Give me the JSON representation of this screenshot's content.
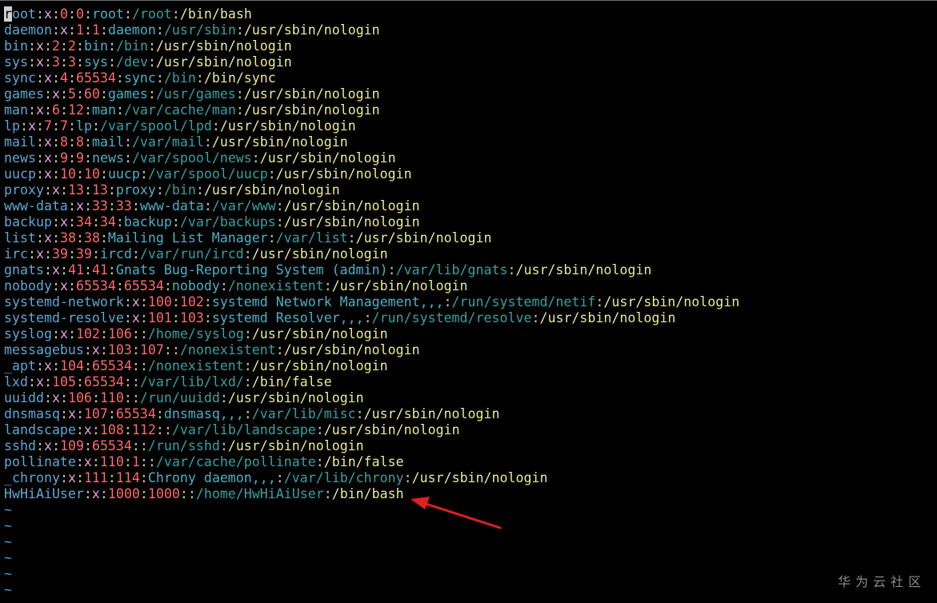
{
  "terminal": {
    "lines": [
      {
        "user": "root",
        "pw": "x",
        "uid": "0",
        "gid": "0",
        "gecos": "root",
        "home": "/root",
        "shell": "/bin/bash"
      },
      {
        "user": "daemon",
        "pw": "x",
        "uid": "1",
        "gid": "1",
        "gecos": "daemon",
        "home": "/usr/sbin",
        "shell": "/usr/sbin/nologin"
      },
      {
        "user": "bin",
        "pw": "x",
        "uid": "2",
        "gid": "2",
        "gecos": "bin",
        "home": "/bin",
        "shell": "/usr/sbin/nologin"
      },
      {
        "user": "sys",
        "pw": "x",
        "uid": "3",
        "gid": "3",
        "gecos": "sys",
        "home": "/dev",
        "shell": "/usr/sbin/nologin"
      },
      {
        "user": "sync",
        "pw": "x",
        "uid": "4",
        "gid": "65534",
        "gecos": "sync",
        "home": "/bin",
        "shell": "/bin/sync"
      },
      {
        "user": "games",
        "pw": "x",
        "uid": "5",
        "gid": "60",
        "gecos": "games",
        "home": "/usr/games",
        "shell": "/usr/sbin/nologin"
      },
      {
        "user": "man",
        "pw": "x",
        "uid": "6",
        "gid": "12",
        "gecos": "man",
        "home": "/var/cache/man",
        "shell": "/usr/sbin/nologin"
      },
      {
        "user": "lp",
        "pw": "x",
        "uid": "7",
        "gid": "7",
        "gecos": "lp",
        "home": "/var/spool/lpd",
        "shell": "/usr/sbin/nologin"
      },
      {
        "user": "mail",
        "pw": "x",
        "uid": "8",
        "gid": "8",
        "gecos": "mail",
        "home": "/var/mail",
        "shell": "/usr/sbin/nologin"
      },
      {
        "user": "news",
        "pw": "x",
        "uid": "9",
        "gid": "9",
        "gecos": "news",
        "home": "/var/spool/news",
        "shell": "/usr/sbin/nologin"
      },
      {
        "user": "uucp",
        "pw": "x",
        "uid": "10",
        "gid": "10",
        "gecos": "uucp",
        "home": "/var/spool/uucp",
        "shell": "/usr/sbin/nologin"
      },
      {
        "user": "proxy",
        "pw": "x",
        "uid": "13",
        "gid": "13",
        "gecos": "proxy",
        "home": "/bin",
        "shell": "/usr/sbin/nologin"
      },
      {
        "user": "www-data",
        "pw": "x",
        "uid": "33",
        "gid": "33",
        "gecos": "www-data",
        "home": "/var/www",
        "shell": "/usr/sbin/nologin"
      },
      {
        "user": "backup",
        "pw": "x",
        "uid": "34",
        "gid": "34",
        "gecos": "backup",
        "home": "/var/backups",
        "shell": "/usr/sbin/nologin"
      },
      {
        "user": "list",
        "pw": "x",
        "uid": "38",
        "gid": "38",
        "gecos": "Mailing List Manager",
        "home": "/var/list",
        "shell": "/usr/sbin/nologin"
      },
      {
        "user": "irc",
        "pw": "x",
        "uid": "39",
        "gid": "39",
        "gecos": "ircd",
        "home": "/var/run/ircd",
        "shell": "/usr/sbin/nologin"
      },
      {
        "user": "gnats",
        "pw": "x",
        "uid": "41",
        "gid": "41",
        "gecos": "Gnats Bug-Reporting System (admin)",
        "home": "/var/lib/gnats",
        "shell": "/usr/sbin/nologin"
      },
      {
        "user": "nobody",
        "pw": "x",
        "uid": "65534",
        "gid": "65534",
        "gecos": "nobody",
        "home": "/nonexistent",
        "shell": "/usr/sbin/nologin"
      },
      {
        "user": "systemd-network",
        "pw": "x",
        "uid": "100",
        "gid": "102",
        "gecos": "systemd Network Management,,,",
        "home": "/run/systemd/netif",
        "shell": "/usr/sbin/nologin"
      },
      {
        "user": "systemd-resolve",
        "pw": "x",
        "uid": "101",
        "gid": "103",
        "gecos": "systemd Resolver,,,",
        "home": "/run/systemd/resolve",
        "shell": "/usr/sbin/nologin"
      },
      {
        "user": "syslog",
        "pw": "x",
        "uid": "102",
        "gid": "106",
        "gecos": "",
        "home": "/home/syslog",
        "shell": "/usr/sbin/nologin"
      },
      {
        "user": "messagebus",
        "pw": "x",
        "uid": "103",
        "gid": "107",
        "gecos": "",
        "home": "/nonexistent",
        "shell": "/usr/sbin/nologin"
      },
      {
        "user": "_apt",
        "pw": "x",
        "uid": "104",
        "gid": "65534",
        "gecos": "",
        "home": "/nonexistent",
        "shell": "/usr/sbin/nologin"
      },
      {
        "user": "lxd",
        "pw": "x",
        "uid": "105",
        "gid": "65534",
        "gecos": "",
        "home": "/var/lib/lxd/",
        "shell": "/bin/false"
      },
      {
        "user": "uuidd",
        "pw": "x",
        "uid": "106",
        "gid": "110",
        "gecos": "",
        "home": "/run/uuidd",
        "shell": "/usr/sbin/nologin"
      },
      {
        "user": "dnsmasq",
        "pw": "x",
        "uid": "107",
        "gid": "65534",
        "gecos": "dnsmasq,,,",
        "home": "/var/lib/misc",
        "shell": "/usr/sbin/nologin"
      },
      {
        "user": "landscape",
        "pw": "x",
        "uid": "108",
        "gid": "112",
        "gecos": "",
        "home": "/var/lib/landscape",
        "shell": "/usr/sbin/nologin"
      },
      {
        "user": "sshd",
        "pw": "x",
        "uid": "109",
        "gid": "65534",
        "gecos": "",
        "home": "/run/sshd",
        "shell": "/usr/sbin/nologin"
      },
      {
        "user": "pollinate",
        "pw": "x",
        "uid": "110",
        "gid": "1",
        "gecos": "",
        "home": "/var/cache/pollinate",
        "shell": "/bin/false"
      },
      {
        "user": "_chrony",
        "pw": "x",
        "uid": "111",
        "gid": "114",
        "gecos": "Chrony daemon,,,",
        "home": "/var/lib/chrony",
        "shell": "/usr/sbin/nologin"
      },
      {
        "user": "HwHiAiUser",
        "pw": "x",
        "uid": "1000",
        "gid": "1000",
        "gecos": "",
        "home": "/home/HwHiAiUser",
        "shell": "/bin/bash"
      }
    ],
    "tilde_lines": [
      "~",
      "~",
      "~",
      "~",
      "~",
      "~"
    ]
  },
  "colors": {
    "background": "#000000",
    "username": "#5fa8d3",
    "password": "#e0a0e0",
    "numbers": "#ff6b6b",
    "gecos": "#4fb0c6",
    "home": "#3aa0a0",
    "shell": "#e8e89a",
    "arrow": "#e02020"
  },
  "annotation": {
    "arrow_icon": "red-arrow-icon"
  },
  "watermark": {
    "text": "华为云社区"
  }
}
